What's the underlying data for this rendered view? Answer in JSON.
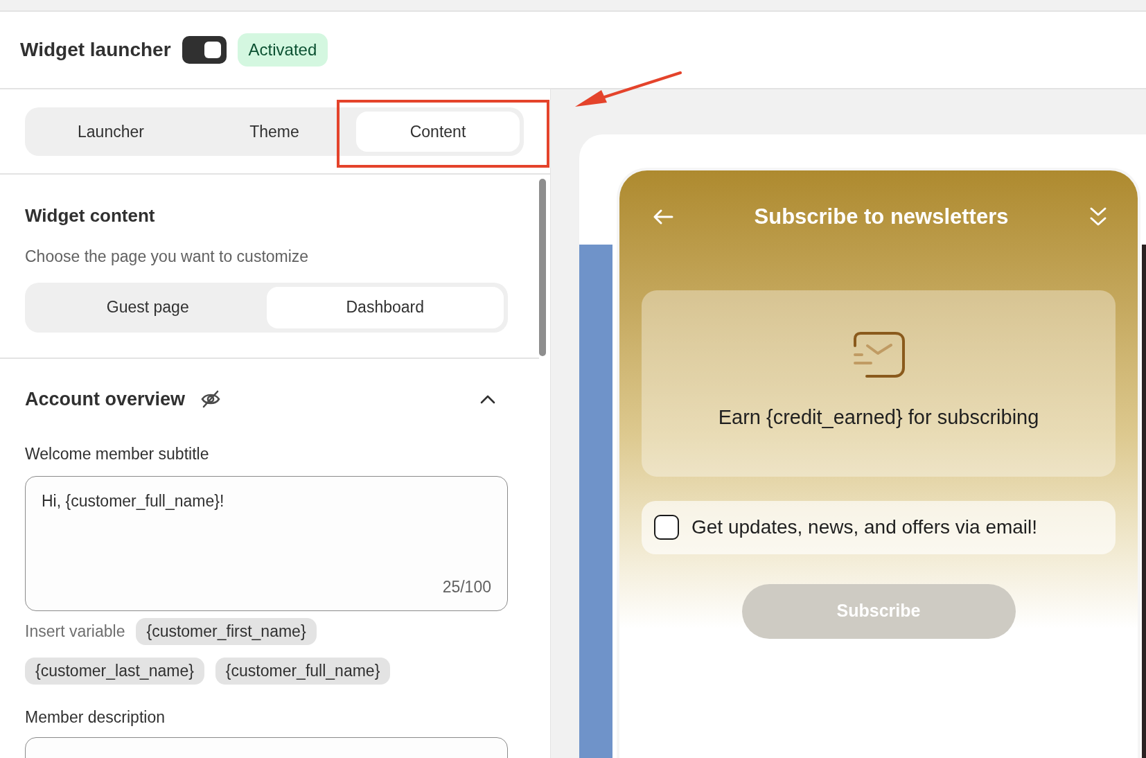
{
  "header": {
    "title": "Widget launcher",
    "toggle_on": true,
    "status_badge": "Activated"
  },
  "tabs": [
    {
      "label": "Launcher",
      "selected": false
    },
    {
      "label": "Theme",
      "selected": false
    },
    {
      "label": "Content",
      "selected": true
    }
  ],
  "widget_content": {
    "title": "Widget content",
    "description": "Choose the page you want to customize",
    "pages": [
      {
        "label": "Guest page",
        "selected": false
      },
      {
        "label": "Dashboard",
        "selected": true
      }
    ]
  },
  "section": {
    "title": "Account overview",
    "expanded": true,
    "subtitle_field": {
      "label": "Welcome member subtitle",
      "value": "Hi, {customer_full_name}!",
      "counter": "25/100"
    },
    "insert_label": "Insert variable",
    "variables": [
      "{customer_first_name}",
      "{customer_last_name}",
      "{customer_full_name}"
    ],
    "description_field": {
      "label": "Member description"
    }
  },
  "preview": {
    "title": "Subscribe to newsletters",
    "message": "Earn {credit_earned} for subscribing",
    "checkbox": {
      "label": "Get updates, news, and offers via email!",
      "checked": false
    },
    "button": "Subscribe"
  }
}
